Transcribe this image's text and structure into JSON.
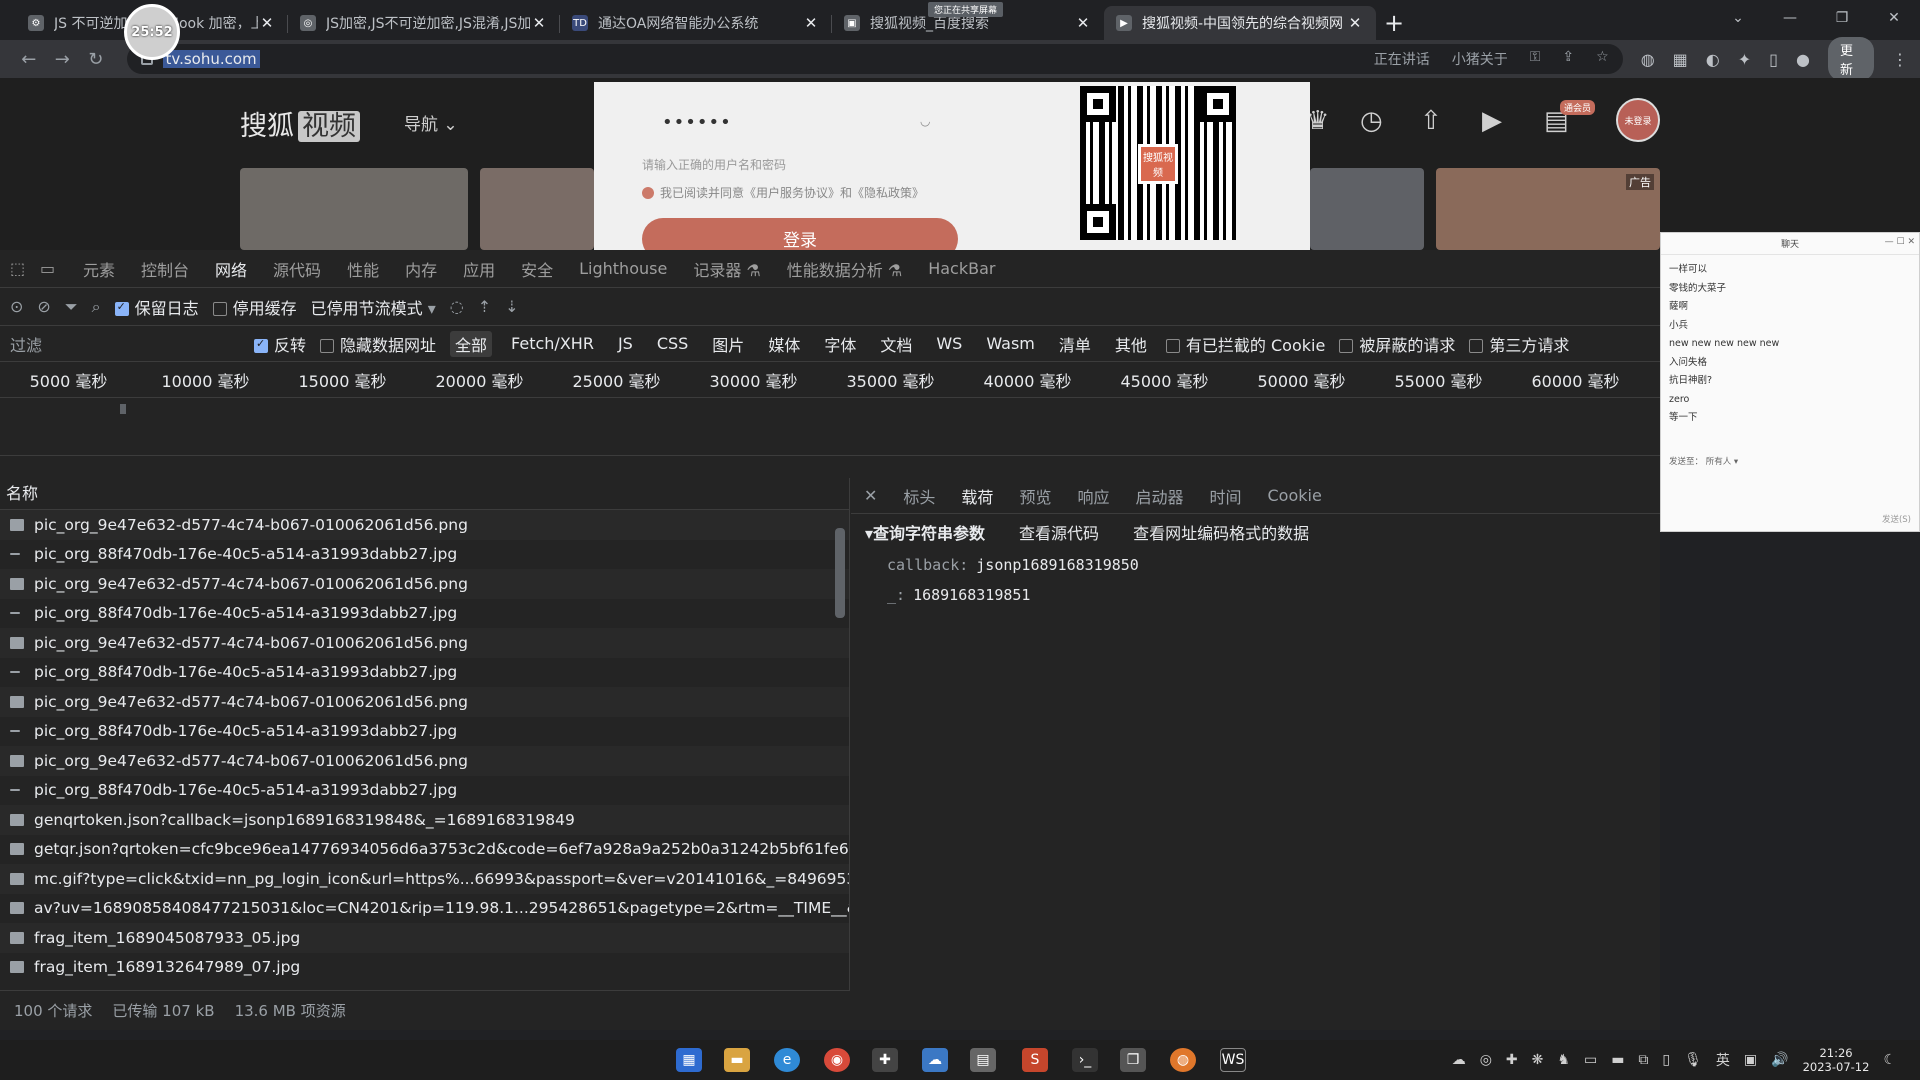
{
  "browser": {
    "tabs": [
      {
        "title": "JS 不可逆加密 - JSHook 加密，上",
        "active": false
      },
      {
        "title": "JS加密,JS不可逆加密,JS混淆,JS加",
        "active": false
      },
      {
        "title": "通达OA网络智能办公系统",
        "active": false
      },
      {
        "title": "搜狐视频_百度搜索",
        "active": false
      },
      {
        "title": "搜狐视频-中国领先的综合视频网",
        "active": true
      }
    ],
    "cursor_badge": "25:52",
    "share_banner": "您正在共享屏幕",
    "url": "tv.sohu.com",
    "omni_right_1": "正在讲话",
    "omni_right_2": "小猪关于",
    "update_label": "更新"
  },
  "page": {
    "logo_text": "搜狐",
    "logo_box": "视频",
    "nav_label": "导航",
    "password_mask": "••••••",
    "login_hint": "请输入正确的用户名和密码",
    "agree_text": "我已阅读并同意《用户服务协议》和《隐私政策》",
    "login_button": "登录",
    "qr_center": "搜狐视频",
    "avatar_text": "未登录",
    "ad_tag": "广告",
    "badge": "通会员"
  },
  "devtools": {
    "tabs": [
      "元素",
      "控制台",
      "网络",
      "源代码",
      "性能",
      "内存",
      "应用",
      "安全",
      "Lighthouse",
      "记录器 ⚗",
      "性能数据分析 ⚗",
      "HackBar"
    ],
    "active_tab": "网络",
    "preserve_log": "保留日志",
    "disable_cache": "停用缓存",
    "throttle": "已停用节流模式",
    "filter_placeholder": "过滤",
    "invert": "反转",
    "hide_data_urls": "隐藏数据网址",
    "types": [
      "全部",
      "Fetch/XHR",
      "JS",
      "CSS",
      "图片",
      "媒体",
      "字体",
      "文档",
      "WS",
      "Wasm",
      "清单",
      "其他"
    ],
    "blocked_cookies": "有已拦截的 Cookie",
    "blocked_requests": "被屏蔽的请求",
    "third_party": "第三方请求",
    "timeline": [
      "5000 毫秒",
      "10000 毫秒",
      "15000 毫秒",
      "20000 毫秒",
      "25000 毫秒",
      "30000 毫秒",
      "35000 毫秒",
      "40000 毫秒",
      "45000 毫秒",
      "50000 毫秒",
      "55000 毫秒",
      "60000 毫秒"
    ],
    "name_header": "名称",
    "requests": [
      {
        "name": "pic_org_9e47e632-d577-4c74-b067-010062061d56.png",
        "icon": "image"
      },
      {
        "name": "pic_org_88f470db-176e-40c5-a514-a31993dabb27.jpg",
        "icon": "dash"
      },
      {
        "name": "pic_org_9e47e632-d577-4c74-b067-010062061d56.png",
        "icon": "image"
      },
      {
        "name": "pic_org_88f470db-176e-40c5-a514-a31993dabb27.jpg",
        "icon": "dash"
      },
      {
        "name": "pic_org_9e47e632-d577-4c74-b067-010062061d56.png",
        "icon": "image"
      },
      {
        "name": "pic_org_88f470db-176e-40c5-a514-a31993dabb27.jpg",
        "icon": "dash"
      },
      {
        "name": "pic_org_9e47e632-d577-4c74-b067-010062061d56.png",
        "icon": "image"
      },
      {
        "name": "pic_org_88f470db-176e-40c5-a514-a31993dabb27.jpg",
        "icon": "dash"
      },
      {
        "name": "pic_org_9e47e632-d577-4c74-b067-010062061d56.png",
        "icon": "image"
      },
      {
        "name": "pic_org_88f470db-176e-40c5-a514-a31993dabb27.jpg",
        "icon": "dash"
      },
      {
        "name": "genqrtoken.json?callback=jsonp1689168319848&_=1689168319849",
        "icon": "json"
      },
      {
        "name": "getqr.json?qrtoken=cfc9bce96ea14776934056d6a3753c2d&code=6ef7a928a9a252b0a31242b5bf61fe61",
        "icon": "image"
      },
      {
        "name": "mc.gif?type=click&txid=nn_pg_login_icon&url=https%...66993&passport=&ver=v20141016&_=8496953...",
        "icon": "doc"
      },
      {
        "name": "av?uv=16890858408477215031&loc=CN4201&rip=119.98.1...295428651&pagetype=2&rtm=__TIME__&...",
        "icon": "doc"
      },
      {
        "name": "frag_item_1689045087933_05.jpg",
        "icon": "image"
      },
      {
        "name": "frag_item_1689132647989_07.jpg",
        "icon": "image"
      }
    ],
    "status": {
      "requests": "100 个请求",
      "transferred": "已传输 107 kB",
      "resources": "13.6 MB 项资源"
    },
    "detail_tabs": [
      "标头",
      "载荷",
      "预览",
      "响应",
      "启动器",
      "时间",
      "Cookie"
    ],
    "detail_active": "载荷",
    "section_title": "▾查询字符串参数",
    "view_source": "查看源代码",
    "view_url_encoded": "查看网址编码格式的数据",
    "params": [
      {
        "key": "callback:",
        "value": "jsonp1689168319850"
      },
      {
        "key": "_:",
        "value": "1689168319851"
      }
    ]
  },
  "chat": {
    "title": "聊天",
    "messages": [
      "一样可以",
      "零钱的大菜子",
      "薩啊",
      "小兵",
      "new new new new new",
      "入问失格",
      "抗日神剧?",
      "zero",
      "等一下"
    ],
    "send_to": "发送至：",
    "recipient": "所有人",
    "hint": "发送(S)"
  },
  "taskbar": {
    "lang": "英",
    "time": "21:26",
    "date": "2023-07-12"
  }
}
